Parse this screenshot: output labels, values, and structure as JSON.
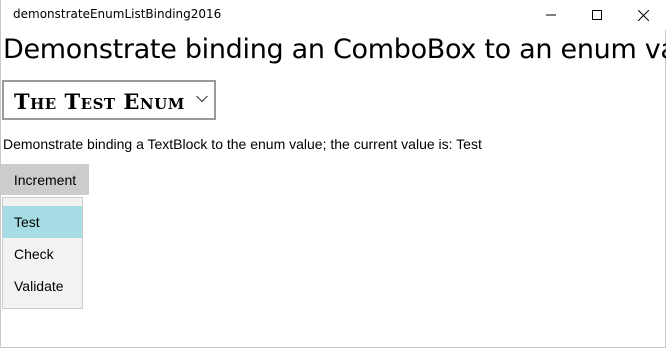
{
  "window": {
    "title": "demonstrateEnumListBinding2016",
    "controls": {
      "minimize_icon": "minimize-icon",
      "maximize_icon": "maximize-icon",
      "close_icon": "close-icon"
    }
  },
  "main": {
    "heading": "Demonstrate binding an ComboBox to an enum va",
    "combo": {
      "selected_value": "The Test Enum",
      "chevron_icon": "chevron-down-icon"
    },
    "status_text": "Demonstrate binding a TextBlock to the enum value; the current value is: Test",
    "increment_button": "Increment",
    "dropdown": {
      "items": [
        {
          "label": "Test",
          "selected": true
        },
        {
          "label": "Check",
          "selected": false
        },
        {
          "label": "Validate",
          "selected": false
        }
      ]
    }
  },
  "colors": {
    "selected_item": "#a6dde4",
    "button_bg": "#cccccc",
    "dropdown_bg": "#f2f2f2",
    "combo_border": "#999999"
  }
}
